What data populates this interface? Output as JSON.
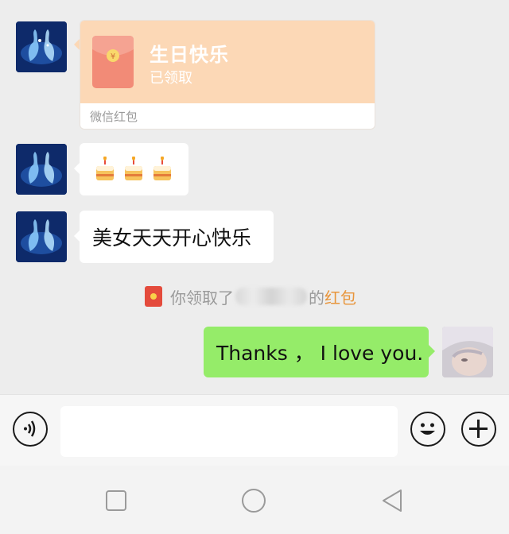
{
  "messages": {
    "red_packet": {
      "title": "生日快乐",
      "status": "已领取",
      "footer": "微信红包"
    },
    "cakes": "🎂🎂🎂",
    "text1": "美女天天开心快乐",
    "notice": {
      "prefix": "你领取了",
      "middle": "的",
      "link": "红包"
    },
    "sent": "Thanks ， I love you."
  },
  "input_bar": {
    "placeholder": ""
  },
  "colors": {
    "chat_bg": "#ededed",
    "packet_top": "#fcd8b6",
    "sent_bubble": "#95ec69",
    "link": "#e8953b"
  },
  "icons": {
    "voice": "voice-icon",
    "emoji": "emoji-icon",
    "plus": "plus-icon",
    "nav_recent": "square-icon",
    "nav_home": "circle-icon",
    "nav_back": "triangle-back-icon"
  }
}
